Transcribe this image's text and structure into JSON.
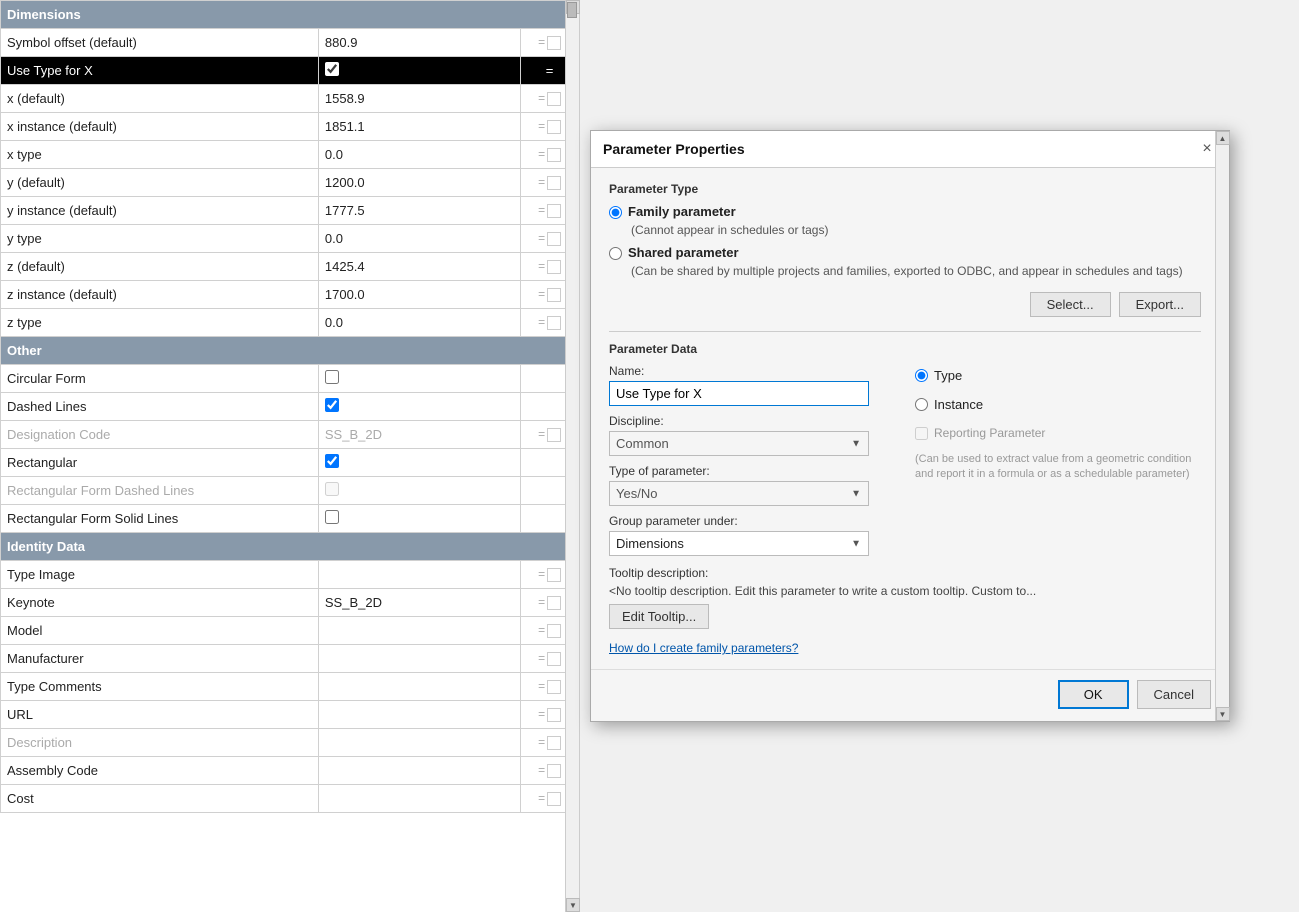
{
  "panel": {
    "sections": [
      {
        "name": "Dimensions",
        "rows": [
          {
            "label": "Symbol offset (default)",
            "value": "880.9",
            "control": "none"
          },
          {
            "label": "Use Type for X",
            "value": "",
            "control": "checkbox",
            "checked": true,
            "selected": true
          },
          {
            "label": "x (default)",
            "value": "1558.9",
            "control": "none"
          },
          {
            "label": "x instance (default)",
            "value": "1851.1",
            "control": "none"
          },
          {
            "label": "x type",
            "value": "0.0",
            "control": "none"
          },
          {
            "label": "y (default)",
            "value": "1200.0",
            "control": "none"
          },
          {
            "label": "y instance (default)",
            "value": "1777.5",
            "control": "none"
          },
          {
            "label": "y type",
            "value": "0.0",
            "control": "none"
          },
          {
            "label": "z (default)",
            "value": "1425.4",
            "control": "none"
          },
          {
            "label": "z instance (default)",
            "value": "1700.0",
            "control": "none"
          },
          {
            "label": "z type",
            "value": "0.0",
            "control": "none"
          }
        ]
      },
      {
        "name": "Other",
        "rows": [
          {
            "label": "Circular Form",
            "value": "",
            "control": "checkbox",
            "checked": false
          },
          {
            "label": "Dashed Lines",
            "value": "",
            "control": "checkbox",
            "checked": true
          },
          {
            "label": "Designation Code",
            "value": "SS_B_2D",
            "control": "none",
            "dimmed": true
          },
          {
            "label": "Rectangular",
            "value": "",
            "control": "checkbox",
            "checked": true
          },
          {
            "label": "Rectangular Form Dashed Lines",
            "value": "",
            "control": "checkbox",
            "checked": false,
            "dimmed": true
          },
          {
            "label": "Rectangular Form Solid Lines",
            "value": "",
            "control": "checkbox",
            "checked": false
          }
        ]
      },
      {
        "name": "Identity Data",
        "rows": [
          {
            "label": "Type Image",
            "value": "",
            "control": "none"
          },
          {
            "label": "Keynote",
            "value": "SS_B_2D",
            "control": "none"
          },
          {
            "label": "Model",
            "value": "",
            "control": "none"
          },
          {
            "label": "Manufacturer",
            "value": "",
            "control": "none"
          },
          {
            "label": "Type Comments",
            "value": "",
            "control": "none"
          },
          {
            "label": "URL",
            "value": "",
            "control": "none"
          },
          {
            "label": "Description",
            "value": "",
            "control": "none",
            "dimmed": true
          },
          {
            "label": "Assembly Code",
            "value": "",
            "control": "none"
          },
          {
            "label": "Cost",
            "value": "",
            "control": "none"
          }
        ]
      }
    ]
  },
  "dialog": {
    "title": "Parameter Properties",
    "close_label": "×",
    "parameter_type_label": "Parameter Type",
    "family_param_label": "Family parameter",
    "family_param_note": "(Cannot appear in schedules or tags)",
    "shared_param_label": "Shared parameter",
    "shared_param_note": "(Can be shared by multiple projects and families, exported to ODBC, and appear in schedules and tags)",
    "select_button": "Select...",
    "export_button": "Export...",
    "param_data_label": "Parameter Data",
    "name_label": "Name:",
    "name_value": "Use Type for X",
    "type_label": "Type",
    "instance_label": "Instance",
    "discipline_label": "Discipline:",
    "discipline_value": "Common",
    "type_of_param_label": "Type of parameter:",
    "type_of_param_value": "Yes/No",
    "group_param_label": "Group parameter under:",
    "group_param_value": "Dimensions",
    "reporting_label": "Reporting Parameter",
    "reporting_note": "(Can be used to extract value from a geometric condition and report it in a formula or as a schedulable parameter)",
    "tooltip_label": "Tooltip description:",
    "tooltip_text": "<No tooltip description. Edit this parameter to write a custom tooltip. Custom to...",
    "edit_tooltip_button": "Edit Tooltip...",
    "help_link": "How do I create family parameters?",
    "ok_button": "OK",
    "cancel_button": "Cancel"
  }
}
